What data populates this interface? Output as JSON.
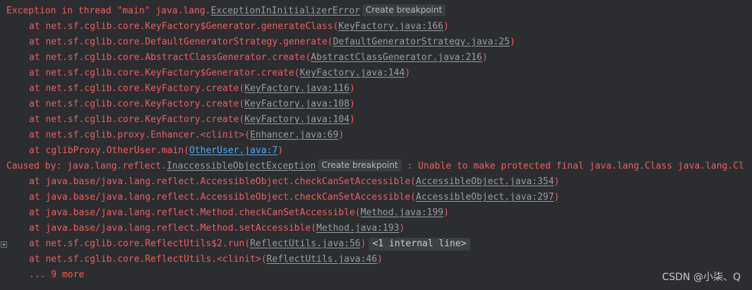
{
  "console": {
    "lines": [
      {
        "indent": 0,
        "prefix": "Exception in thread \"main\" java.lang.",
        "link": "ExceptionInInitializerError",
        "link_kind": "class",
        "chip": "Create breakpoint",
        "suffix": ""
      },
      {
        "indent": 1,
        "prefix": "at net.sf.cglib.core.KeyFactory$Generator.generateClass(",
        "link": "KeyFactory.java:166",
        "link_kind": "file",
        "suffix": ")"
      },
      {
        "indent": 1,
        "prefix": "at net.sf.cglib.core.DefaultGeneratorStrategy.generate(",
        "link": "DefaultGeneratorStrategy.java:25",
        "link_kind": "file",
        "suffix": ")"
      },
      {
        "indent": 1,
        "prefix": "at net.sf.cglib.core.AbstractClassGenerator.create(",
        "link": "AbstractClassGenerator.java:216",
        "link_kind": "file",
        "suffix": ")"
      },
      {
        "indent": 1,
        "prefix": "at net.sf.cglib.core.KeyFactory$Generator.create(",
        "link": "KeyFactory.java:144",
        "link_kind": "file",
        "suffix": ")"
      },
      {
        "indent": 1,
        "prefix": "at net.sf.cglib.core.KeyFactory.create(",
        "link": "KeyFactory.java:116",
        "link_kind": "file",
        "suffix": ")"
      },
      {
        "indent": 1,
        "prefix": "at net.sf.cglib.core.KeyFactory.create(",
        "link": "KeyFactory.java:108",
        "link_kind": "file",
        "suffix": ")"
      },
      {
        "indent": 1,
        "prefix": "at net.sf.cglib.core.KeyFactory.create(",
        "link": "KeyFactory.java:104",
        "link_kind": "file",
        "suffix": ")"
      },
      {
        "indent": 1,
        "prefix": "at net.sf.cglib.proxy.Enhancer.<clinit>(",
        "link": "Enhancer.java:69",
        "link_kind": "file",
        "suffix": ")"
      },
      {
        "indent": 1,
        "prefix": "at cglibProxy.OtherUser.main(",
        "link": "OtherUser.java:7",
        "link_kind": "user",
        "suffix": ")"
      },
      {
        "indent": 0,
        "prefix": "Caused by: java.lang.reflect.",
        "link": "InaccessibleObjectException",
        "link_kind": "class",
        "chip": "Create breakpoint",
        "suffix": " : Unable to make protected final java.lang.Class java.lang.Cl"
      },
      {
        "indent": 1,
        "prefix": "at java.base/java.lang.reflect.AccessibleObject.checkCanSetAccessible(",
        "link": "AccessibleObject.java:354",
        "link_kind": "file",
        "suffix": ")"
      },
      {
        "indent": 1,
        "prefix": "at java.base/java.lang.reflect.AccessibleObject.checkCanSetAccessible(",
        "link": "AccessibleObject.java:297",
        "link_kind": "file",
        "suffix": ")"
      },
      {
        "indent": 1,
        "prefix": "at java.base/java.lang.reflect.Method.checkCanSetAccessible(",
        "link": "Method.java:199",
        "link_kind": "file",
        "suffix": ")"
      },
      {
        "indent": 1,
        "prefix": "at java.base/java.lang.reflect.Method.setAccessible(",
        "link": "Method.java:193",
        "link_kind": "file",
        "suffix": ")"
      },
      {
        "indent": 1,
        "prefix": "at net.sf.cglib.core.ReflectUtils$2.run(",
        "link": "ReflectUtils.java:56",
        "link_kind": "file",
        "suffix": ")",
        "fold": "<1 internal line>",
        "gutter": "expand-icon"
      },
      {
        "indent": 1,
        "prefix": "at net.sf.cglib.core.ReflectUtils.<clinit>(",
        "link": "ReflectUtils.java:46",
        "link_kind": "file",
        "suffix": ")"
      },
      {
        "indent": 1,
        "prefix": "... 9 more"
      }
    ]
  },
  "watermark": "CSDN @小柒、Q",
  "colors": {
    "background": "#2b2d30",
    "error_text": "#ef5f5f",
    "link_gray": "#9a9da3",
    "link_blue": "#56a8f5",
    "chip_bg": "#3a3d41",
    "chip_text": "#b6b9be"
  }
}
